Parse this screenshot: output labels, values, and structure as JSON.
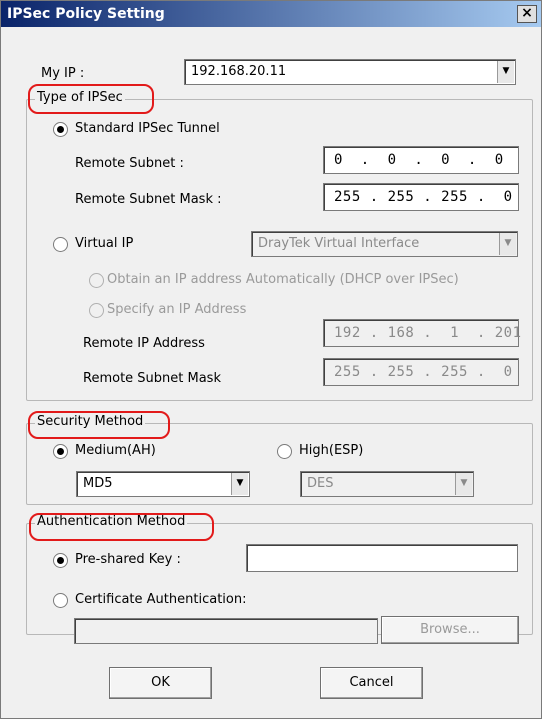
{
  "window": {
    "title": "IPSec Policy Setting",
    "close_icon": "×"
  },
  "my_ip": {
    "label": "My IP :",
    "value": "192.168.20.11"
  },
  "type_of_ipsec": {
    "legend": "Type of IPSec",
    "standard": {
      "label": "Standard IPSec Tunnel",
      "remote_subnet_label": "Remote Subnet :",
      "remote_subnet_value": "0  .  0  .  0  .  0",
      "remote_subnet_mask_label": "Remote Subnet Mask :",
      "remote_subnet_mask_value": "255 . 255 . 255 .  0"
    },
    "virtual_ip": {
      "label": "Virtual IP",
      "interface_value": "DrayTek Virtual Interface",
      "obtain_auto_label": "Obtain an IP address Automatically (DHCP over IPSec)",
      "specify_label": "Specify an IP Address",
      "remote_ip_label": "Remote IP Address",
      "remote_ip_value": "192 . 168 .  1  . 201",
      "remote_mask_label": "Remote Subnet Mask",
      "remote_mask_value": "255 . 255 . 255 .  0"
    }
  },
  "security_method": {
    "legend": "Security Method",
    "medium_label": "Medium(AH)",
    "medium_value": "MD5",
    "high_label": "High(ESP)",
    "high_value": "DES"
  },
  "authentication_method": {
    "legend": "Authentication Method",
    "preshared_label": "Pre-shared Key :",
    "preshared_value": "",
    "certificate_label": "Certificate Authentication:",
    "browse_label": "Browse..."
  },
  "buttons": {
    "ok": "OK",
    "cancel": "Cancel"
  },
  "colors": {
    "highlight": "#e21a1a"
  }
}
